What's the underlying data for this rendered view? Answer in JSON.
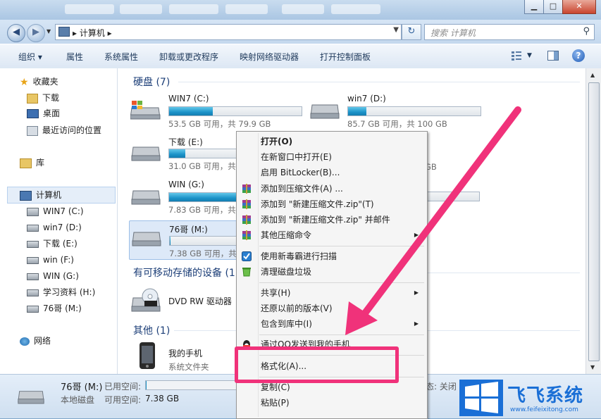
{
  "window": {
    "blurred_tabs": [
      "",
      "",
      "",
      "",
      "",
      ""
    ],
    "controls": {
      "minimize": "▁",
      "maximize": "□",
      "close": "✕"
    }
  },
  "address": {
    "path": "▸ 计算机 ▸",
    "search_placeholder": "搜索 计算机"
  },
  "toolbar": {
    "organize": "组织 ▾",
    "properties": "属性",
    "system_properties": "系统属性",
    "uninstall": "卸载或更改程序",
    "map_drive": "映射网络驱动器",
    "control_panel": "打开控制面板",
    "help": "?"
  },
  "sidebar": {
    "favorites": "收藏夹",
    "downloads": "下载",
    "desktop": "桌面",
    "recent": "最近访问的位置",
    "libraries": "库",
    "computer": "计算机",
    "drives": [
      "WIN7 (C:)",
      "win7 (D:)",
      "下载 (E:)",
      "win (F:)",
      "WIN (G:)",
      "学习资料 (H:)",
      "76哥 (M:)"
    ],
    "network": "网络"
  },
  "sections": {
    "hdd": "硬盘 (7)",
    "removable": "有可移动存储的设备 (1)",
    "other": "其他 (1)"
  },
  "drives": [
    {
      "name": "WIN7 (C:)",
      "space": "53.5 GB 可用，共 79.9 GB",
      "used_pct": 33
    },
    {
      "name": "win7 (D:)",
      "space": "85.7 GB 可用，共 100 GB",
      "used_pct": 14
    },
    {
      "name": "下载 (E:)",
      "space": "31.0 GB 可用，共",
      "used_pct": 12
    },
    {
      "name": "",
      "space": "9 GB",
      "used_pct": 0
    },
    {
      "name": "WIN (G:)",
      "space": "7.83 GB 可用，共",
      "used_pct": 85
    },
    {
      "name": "76哥 (M:)",
      "space": "7.38 GB 可用，共",
      "used_pct": 1
    }
  ],
  "dvd": {
    "name": "DVD RW 驱动器"
  },
  "phone": {
    "name": "我的手机",
    "type": "系统文件夹"
  },
  "status": {
    "name": "76哥 (M:)",
    "used_label": "已用空间:",
    "type": "本地磁盘",
    "free_label": "可用空间:",
    "free": "7.38 GB",
    "state": "态: 关闭"
  },
  "context_menu": {
    "items": [
      {
        "label": "打开(O)",
        "bold": true
      },
      {
        "label": "在新窗口中打开(E)"
      },
      {
        "label": "启用 BitLocker(B)..."
      },
      {
        "label": "添加到压缩文件(A) ...",
        "icon": "winrar"
      },
      {
        "label": "添加到 \"新建压缩文件.zip\"(T)",
        "icon": "winrar"
      },
      {
        "label": "添加到 \"新建压缩文件.zip\" 并邮件",
        "icon": "winrar"
      },
      {
        "label": "其他压缩命令",
        "icon": "winrar",
        "submenu": true
      },
      {
        "label": "使用新毒霸进行扫描",
        "icon": "duba"
      },
      {
        "label": "清理磁盘垃圾",
        "icon": "clean"
      },
      {
        "label": "共享(H)",
        "submenu": true
      },
      {
        "label": "还原以前的版本(V)"
      },
      {
        "label": "包含到库中(I)",
        "submenu": true
      },
      {
        "label": "通过QQ发送到我的手机",
        "icon": "qq"
      },
      {
        "label": "格式化(A)..."
      },
      {
        "label": "复制(C)"
      },
      {
        "label": "粘贴(P)"
      }
    ]
  },
  "watermark": {
    "brand": "飞飞系统",
    "url": "www.feifeixitong.com"
  },
  "colors": {
    "highlight": "#f0327a",
    "accent": "#1c93c9"
  }
}
